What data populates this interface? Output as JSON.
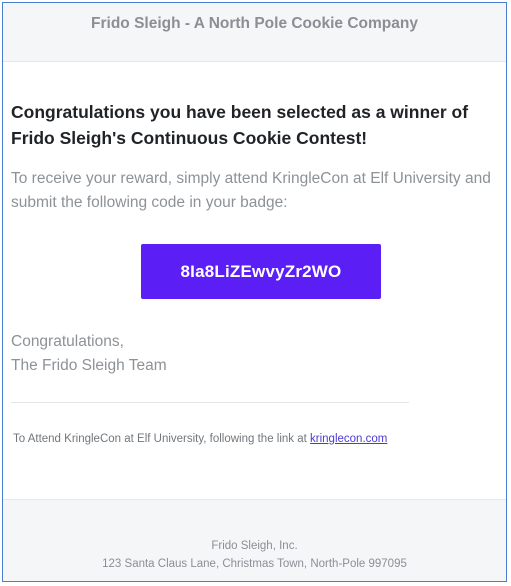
{
  "header": {
    "title": "Frido Sleigh - A North Pole Cookie Company"
  },
  "message": {
    "headline": "Congratulations you have been selected as a winner of Frido Sleigh's Continuous Cookie Contest!",
    "intro": "To receive your reward, simply attend KringleCon at Elf University and submit the following code in your badge:",
    "code": "8Ia8LiZEwvyZr2WO",
    "signoff_line1": "Congratulations,",
    "signoff_line2": "The Frido Sleigh Team"
  },
  "attend": {
    "text": "To Attend KringleCon at Elf University, following the link at ",
    "link_text": "kringlecon.com"
  },
  "footer": {
    "company": "Frido Sleigh, Inc.",
    "address": "123 Santa Claus Lane, Christmas Town, North-Pole 997095"
  },
  "colors": {
    "code_button_bg": "#5b1ff5",
    "frame_border": "#4a7fd0",
    "link": "#4a3ad6"
  }
}
